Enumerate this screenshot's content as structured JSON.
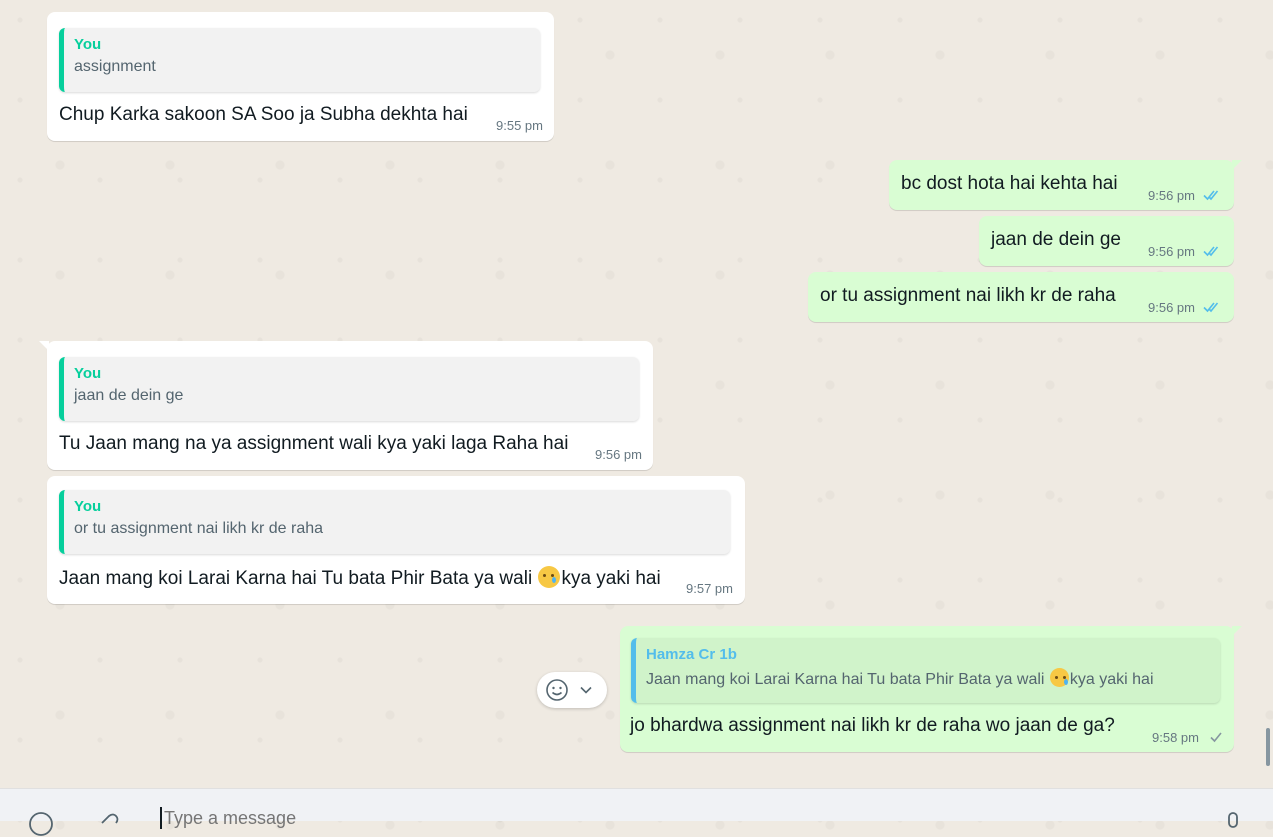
{
  "messages": [
    {
      "quote_author": "You",
      "quote_text": "assignment",
      "text": "Chup Karka sakoon SA Soo ja Subha dekhta hai",
      "time": "9:55 pm"
    },
    {
      "text": "bc dost hota hai kehta hai",
      "time": "9:56 pm",
      "status": "read"
    },
    {
      "text": "jaan de dein ge",
      "time": "9:56 pm",
      "status": "read"
    },
    {
      "text": "or tu assignment nai likh kr de raha",
      "time": "9:56 pm",
      "status": "read"
    },
    {
      "quote_author": "You",
      "quote_text": "jaan de dein ge",
      "text": "Tu Jaan mang na ya assignment wali kya yaki laga Raha hai",
      "time": "9:56 pm"
    },
    {
      "quote_author": "You",
      "quote_text": "or tu assignment nai likh kr de raha",
      "text_before": "Jaan mang koi Larai Karna hai Tu bata Phir Bata ya wali ",
      "text_after": "kya yaki hai",
      "time": "9:57 pm"
    },
    {
      "quote_author": "Hamza Cr 1b",
      "quote_text_before": "Jaan mang koi Larai Karna hai Tu bata Phir Bata ya wali ",
      "quote_text_after": "kya yaki hai",
      "text": "jo bhardwa assignment nai likh kr de raha wo jaan de ga?",
      "time": "9:58 pm",
      "status": "sent"
    }
  ],
  "emoji": "crying-face-emoji",
  "composer": {
    "placeholder": "Type a message"
  },
  "colors": {
    "incoming": "#ffffff",
    "outgoing": "#d9fdd3",
    "you_accent": "#06cf9c",
    "contact_accent": "#53bdeb",
    "read_tick": "#53bdeb"
  }
}
